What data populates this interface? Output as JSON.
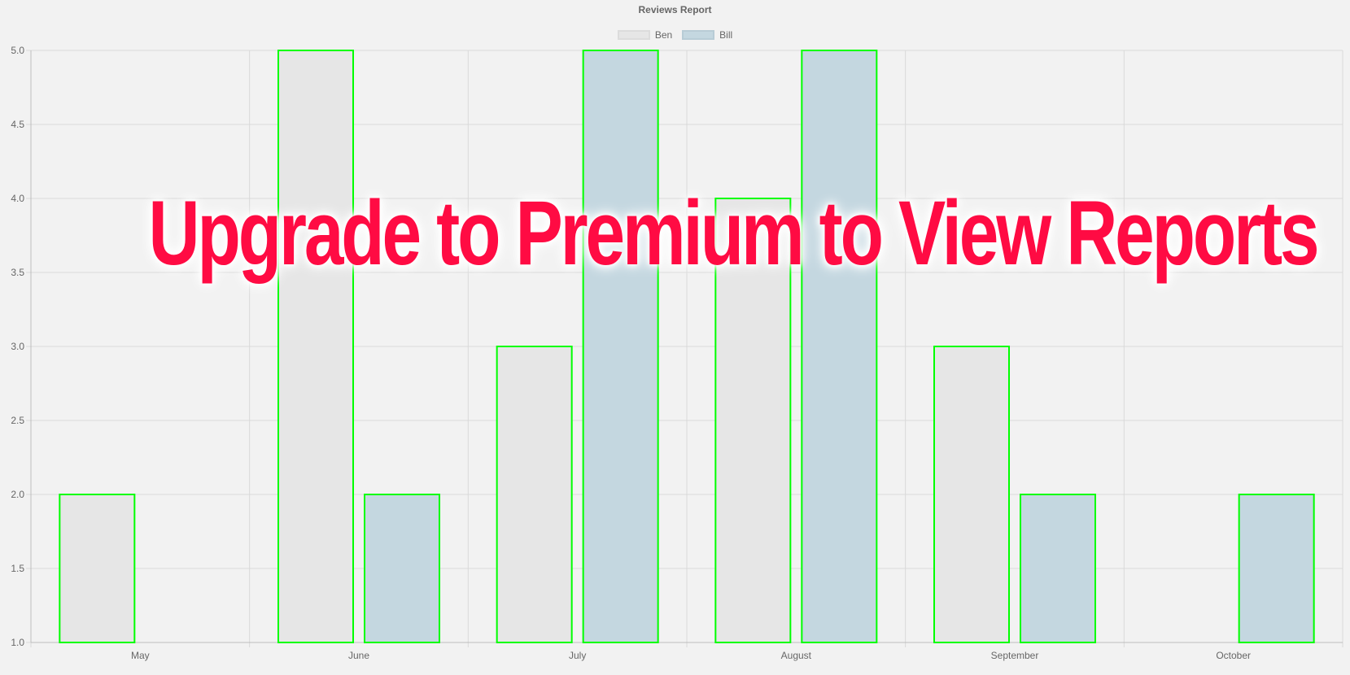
{
  "overlay_text": "Upgrade to Premium to View Reports",
  "chart_data": {
    "type": "bar",
    "title": "Reviews Report",
    "categories": [
      "May",
      "June",
      "July",
      "August",
      "September",
      "October"
    ],
    "series": [
      {
        "name": "Ben",
        "values": [
          2,
          5,
          3,
          4,
          3,
          1
        ],
        "fill": "#e6e6e6",
        "stroke": "#00ff00"
      },
      {
        "name": "Bill",
        "values": [
          1,
          2,
          5,
          5,
          2,
          2
        ],
        "fill": "#c4d7e0",
        "stroke": "#00ff00"
      }
    ],
    "ylim": [
      1.0,
      5.0
    ],
    "yticks": [
      "1.0",
      "1.5",
      "2.0",
      "2.5",
      "3.0",
      "3.5",
      "4.0",
      "4.5",
      "5.0"
    ],
    "grid": true,
    "legend": "top-center"
  }
}
